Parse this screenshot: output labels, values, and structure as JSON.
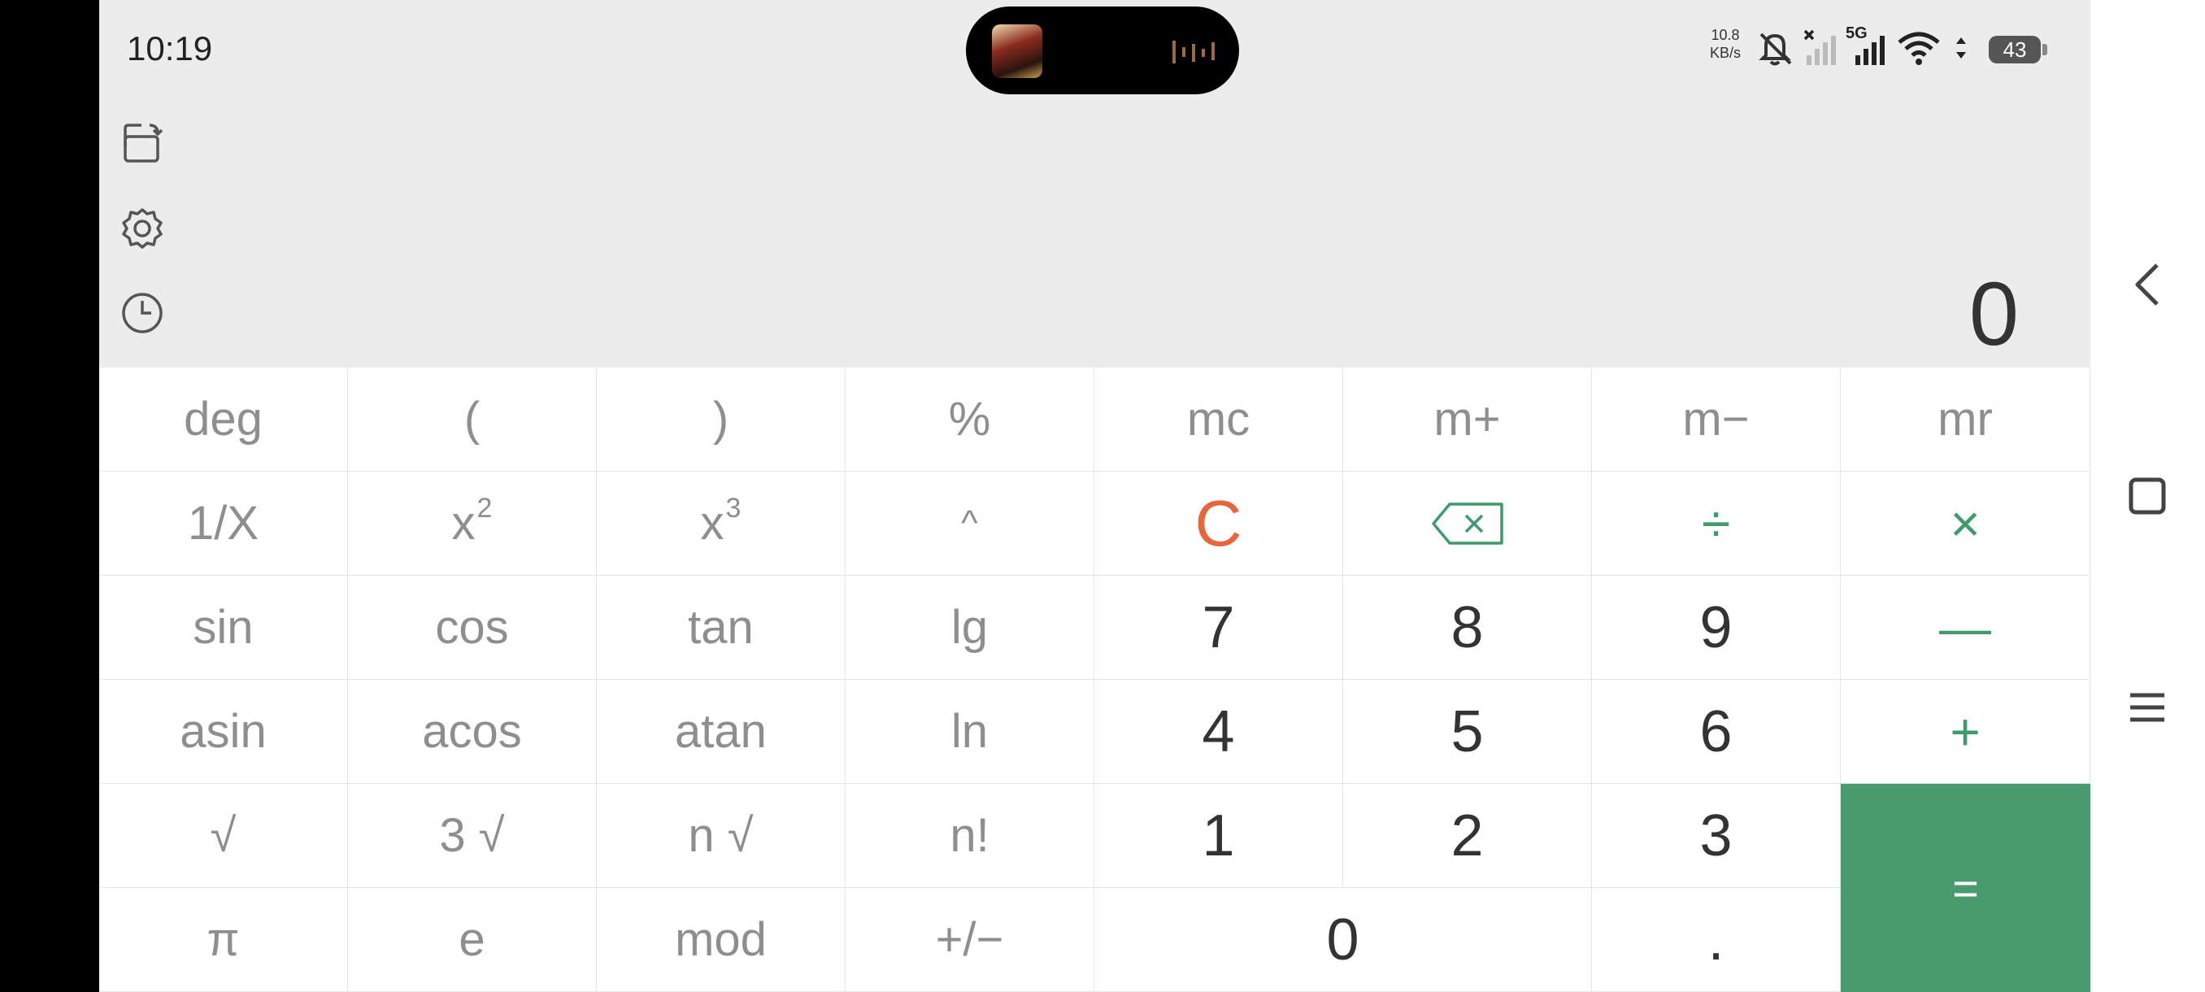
{
  "status_bar": {
    "time": "10:19",
    "net_speed_value": "10.8",
    "net_speed_unit": "KB/s",
    "network_label": "5G",
    "battery_level": "43"
  },
  "display": {
    "value": "0"
  },
  "keypad": {
    "row1": [
      "deg",
      "(",
      ")",
      "%",
      "mc",
      "m+",
      "m−",
      "mr"
    ],
    "row2": {
      "reciprocal": "1/X",
      "square_base": "x",
      "square_exp": "2",
      "cube_base": "x",
      "cube_exp": "3",
      "power": "^",
      "clear": "C",
      "divide": "÷",
      "multiply": "×"
    },
    "row3": [
      "sin",
      "cos",
      "tan",
      "lg",
      "7",
      "8",
      "9",
      "—"
    ],
    "row4": [
      "asin",
      "acos",
      "atan",
      "ln",
      "4",
      "5",
      "6",
      "+"
    ],
    "row5": [
      "√",
      "3 √",
      "n √",
      "n!",
      "1",
      "2",
      "3"
    ],
    "row6": [
      "π",
      "e",
      "mod",
      "+/−",
      "0",
      "."
    ],
    "equals": "="
  },
  "colors": {
    "accent_green": "#4a9a70",
    "clear_orange": "#e8663c",
    "function_gray": "#8e8e8e",
    "display_bg": "#ececec"
  },
  "icons": {
    "rotate": "rotate-screen-icon",
    "settings": "gear-icon",
    "history": "clock-icon",
    "backspace": "backspace-icon",
    "nav_back": "chevron-left-icon",
    "nav_home": "square-icon",
    "nav_recents": "menu-icon"
  }
}
